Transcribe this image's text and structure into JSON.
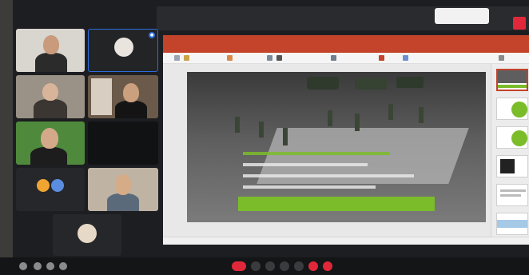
{
  "call": {
    "top_notice": "",
    "status_text": "",
    "end_label": "",
    "meeting_code": ""
  },
  "participants": [
    {
      "name": ""
    },
    {
      "name": ""
    },
    {
      "name": ""
    },
    {
      "name": ""
    },
    {
      "name": ""
    },
    {
      "name": ""
    },
    {
      "name": "",
      "initials": [
        "",
        ""
      ]
    },
    {
      "name": ""
    },
    {
      "name": ""
    }
  ],
  "presentation": {
    "slide_caption": "",
    "colors": {
      "accent": "#7bbc2a",
      "ribbon": "#c4432b",
      "slide_bg": "#4a4a4a"
    }
  },
  "icons": [
    "mic-icon",
    "camera-icon",
    "screen-share-icon",
    "chat-icon",
    "more-icon",
    "hang-up-icon",
    "info-icon",
    "people-icon",
    "layout-icon"
  ]
}
